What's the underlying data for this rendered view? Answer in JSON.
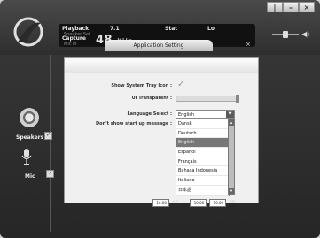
{
  "window": {
    "buttons": [
      "|",
      "–",
      "×"
    ]
  },
  "status": {
    "playback": "Playback",
    "speaker_set": "Speaker Set",
    "capture": "Capture",
    "mic_in": "Mic in",
    "col2": "7.1",
    "col3": "Stat",
    "col4": "Lo",
    "big_value": "48",
    "big_unit": "KHz"
  },
  "dialog": {
    "title": "Application Setting",
    "close": "×",
    "labels": {
      "tray_icon": "Show System Tray Icon :",
      "transparent": "UI Transparent :",
      "language": "Language Select :",
      "startup": "Don't show start up message :"
    },
    "language_selected": "English",
    "language_options": [
      "Dansk",
      "Deutsch",
      "English",
      "Español",
      "Français",
      "Bahasa Indonesia",
      "Italiano",
      "日本語"
    ],
    "dropdown_highlighted_index": 2,
    "transparency_level": 0.95
  },
  "bottom": {
    "values": [
      "-10.00",
      "-10.00",
      "-10.00"
    ],
    "unit": "dB"
  },
  "sidebar": {
    "speakers_label": "Speakers",
    "mic_label": "Mic",
    "check_mark": "✓"
  }
}
